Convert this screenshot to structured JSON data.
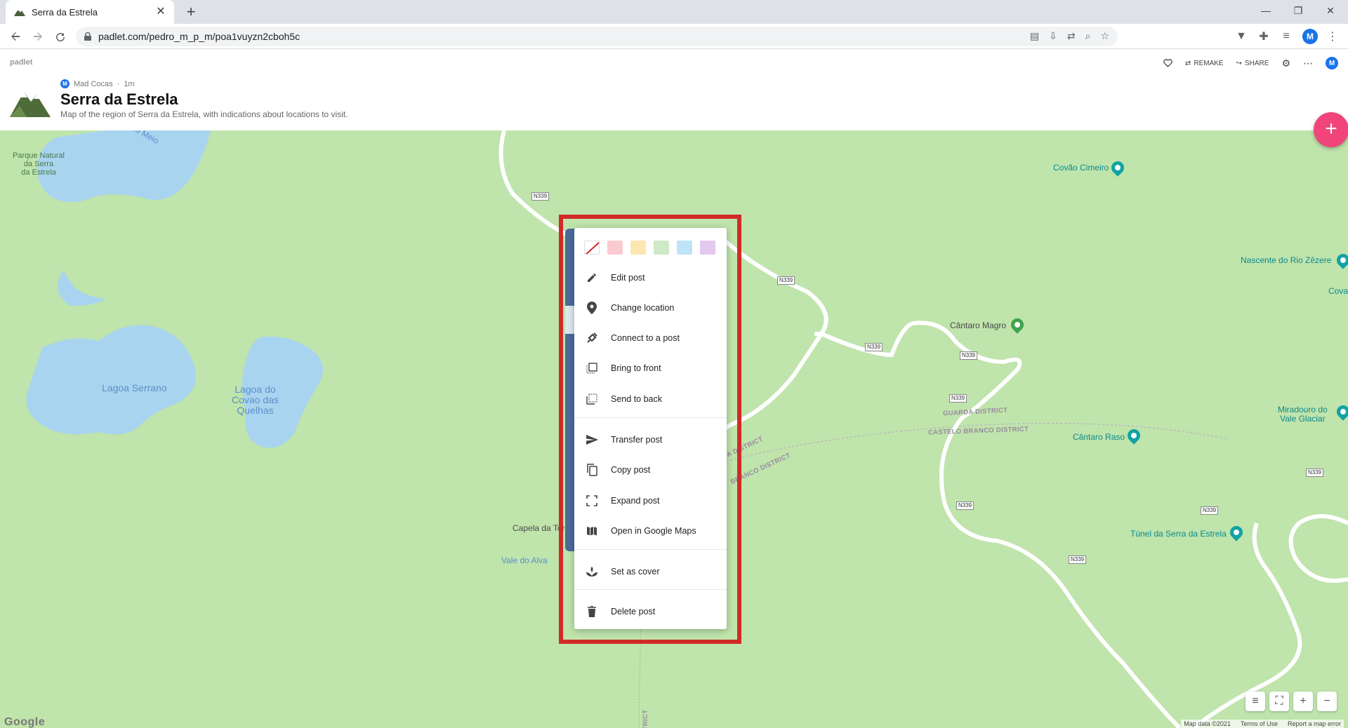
{
  "browser": {
    "tab_title": "Serra da Estrela",
    "url": "padlet.com/pedro_m_p_m/poa1vuyzn2cboh5c",
    "profile_initial": "M"
  },
  "header": {
    "brand": "padlet",
    "author": "Mad Cocas",
    "author_initial": "M",
    "time": "1m",
    "title": "Serra da Estrela",
    "description": "Map of the region of Serra da Estrela, with indications about locations to visit.",
    "remake_label": "REMAKE",
    "share_label": "SHARE",
    "user_initial": "M"
  },
  "map": {
    "labels": {
      "parque": "Parque Natural\nda Serra\nda Estrela",
      "lagoa_serrano": "Lagoa Serrano",
      "lagoa_covao": "Lagoa do\nCovao das\nQuelhas",
      "rio_meio": "do Meio",
      "covao_cimeiro": "Covão Cimeiro",
      "nascente": "Nascente do Rio Zêzere",
      "cova": "Cova",
      "cantaro_magro": "Cântaro Magro",
      "guarda": "GUARDA DISTRICT",
      "castelo": "CASTELO BRANCO DISTRICT",
      "cantaro_raso": "Cântaro Raso",
      "miradouro": "Miradouro do\nVale Glaciar",
      "capela": "Capela da Torre",
      "vale_alva": "Vale do Alva",
      "tunel": "Túnel da Serra da Estrela",
      "dist_a": "A DISTRICT",
      "dist_b": "BRANCO DISTRICT",
      "dist_c": "TRICT"
    },
    "road": "N339",
    "google": "Google",
    "attrib_data": "Map data ©2021",
    "attrib_terms": "Terms of Use",
    "attrib_report": "Report a map error"
  },
  "context_menu": {
    "colors": [
      "#ffffff",
      "#fbcad0",
      "#fde6b0",
      "#cfe8c6",
      "#bfe3f7",
      "#e3c8ef"
    ],
    "items": {
      "edit": "Edit post",
      "location": "Change location",
      "connect": "Connect to a post",
      "front": "Bring to front",
      "back": "Send to back",
      "transfer": "Transfer post",
      "copy": "Copy post",
      "expand": "Expand post",
      "gmaps": "Open in Google Maps",
      "cover": "Set as cover",
      "delete": "Delete post"
    }
  }
}
